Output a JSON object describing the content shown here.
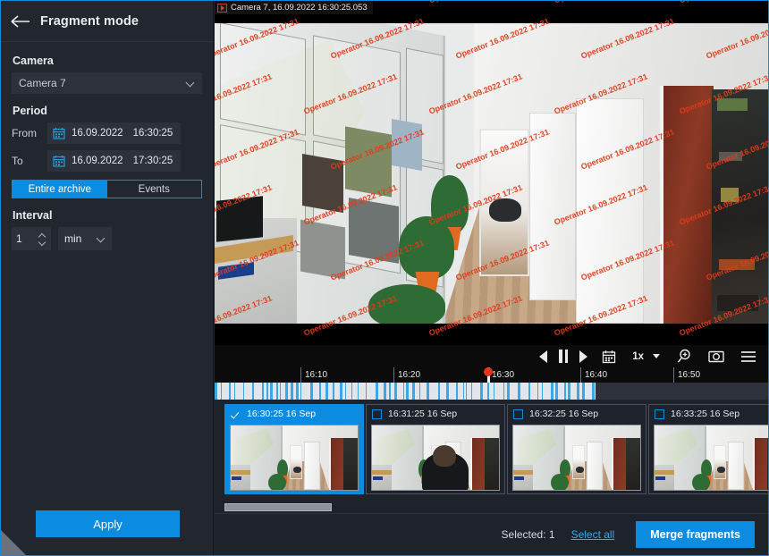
{
  "sidebar": {
    "title": "Fragment mode",
    "back_icon": "back-arrow-icon",
    "camera_label": "Camera",
    "camera_value": "Camera 7",
    "period_label": "Period",
    "from_label": "From",
    "to_label": "To",
    "from_date": "16.09.2022",
    "from_time": "16:30:25",
    "to_date": "16.09.2022",
    "to_time": "17:30:25",
    "mode_tabs": [
      {
        "label": "Entire archive",
        "active": true
      },
      {
        "label": "Events",
        "active": false
      }
    ],
    "interval_label": "Interval",
    "interval_value": "1",
    "interval_unit": "min",
    "apply_label": "Apply"
  },
  "video": {
    "caption": "Camera 7, 16.09.2022 16:30:25.053",
    "play_badge_icon": "play-badge-icon",
    "watermark_text": "Operator 16.09.2022 17:31",
    "watermark_color": "#e5391a",
    "controls": {
      "prev_frame_icon": "previous-frame-icon",
      "pause_icon": "pause-icon",
      "next_frame_icon": "next-frame-icon",
      "calendar_icon": "calendar-icon",
      "speed_value": "1x",
      "speed_caret_icon": "caret-down-icon",
      "zoom_icon": "magnifier-plus-icon",
      "snapshot_icon": "camera-snapshot-icon",
      "menu_icon": "hamburger-menu-icon"
    },
    "timeline": {
      "ticks": [
        "16:10",
        "16:20",
        "16:30",
        "16:40",
        "16:50"
      ],
      "playhead_label": "16:30",
      "archive_color": "#e2e6ea",
      "motion_color": "#3aa8e8"
    }
  },
  "thumbnails": [
    {
      "time": "16:30:25 16 Sep",
      "selected": true
    },
    {
      "time": "16:31:25 16 Sep",
      "selected": false
    },
    {
      "time": "16:32:25 16 Sep",
      "selected": false
    },
    {
      "time": "16:33:25 16 Sep",
      "selected": false
    }
  ],
  "footer": {
    "selected_text": "Selected: 1",
    "select_all_label": "Select all",
    "merge_label": "Merge fragments"
  },
  "colors": {
    "accent": "#0c8ce0",
    "panel": "#22262f",
    "background": "#1e222b",
    "field": "#2c313b"
  }
}
